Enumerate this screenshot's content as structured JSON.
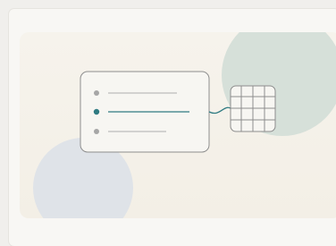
{
  "illustration": {
    "list_items": [
      {
        "state": "inactive"
      },
      {
        "state": "active"
      },
      {
        "state": "inactive"
      }
    ],
    "colors": {
      "accent": "#2f7b82",
      "inactive_dot": "#a6a6a6",
      "line": "#bdbdbd",
      "card_border": "#8d8d8d",
      "blob_teal": "#d6e0d9",
      "blob_blue": "#dfe3e8"
    },
    "grid": {
      "columns": 4,
      "rows": 4
    }
  }
}
